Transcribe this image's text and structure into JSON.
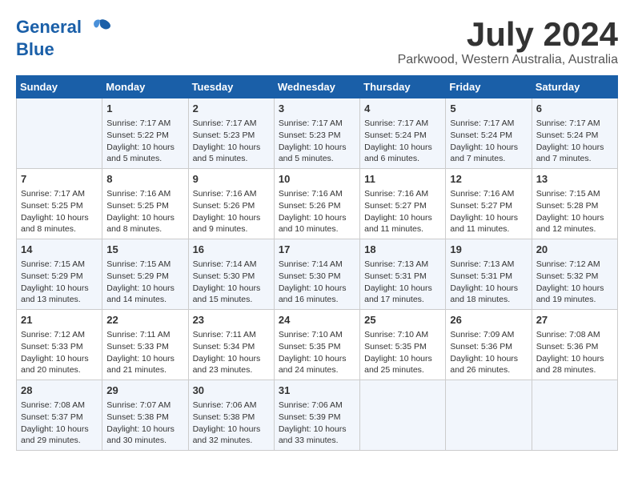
{
  "logo": {
    "line1": "General",
    "line2": "Blue"
  },
  "title": "July 2024",
  "subtitle": "Parkwood, Western Australia, Australia",
  "calendar": {
    "headers": [
      "Sunday",
      "Monday",
      "Tuesday",
      "Wednesday",
      "Thursday",
      "Friday",
      "Saturday"
    ],
    "weeks": [
      [
        {
          "day": "",
          "content": ""
        },
        {
          "day": "1",
          "content": "Sunrise: 7:17 AM\nSunset: 5:22 PM\nDaylight: 10 hours\nand 5 minutes."
        },
        {
          "day": "2",
          "content": "Sunrise: 7:17 AM\nSunset: 5:23 PM\nDaylight: 10 hours\nand 5 minutes."
        },
        {
          "day": "3",
          "content": "Sunrise: 7:17 AM\nSunset: 5:23 PM\nDaylight: 10 hours\nand 5 minutes."
        },
        {
          "day": "4",
          "content": "Sunrise: 7:17 AM\nSunset: 5:24 PM\nDaylight: 10 hours\nand 6 minutes."
        },
        {
          "day": "5",
          "content": "Sunrise: 7:17 AM\nSunset: 5:24 PM\nDaylight: 10 hours\nand 7 minutes."
        },
        {
          "day": "6",
          "content": "Sunrise: 7:17 AM\nSunset: 5:24 PM\nDaylight: 10 hours\nand 7 minutes."
        }
      ],
      [
        {
          "day": "7",
          "content": "Sunrise: 7:17 AM\nSunset: 5:25 PM\nDaylight: 10 hours\nand 8 minutes."
        },
        {
          "day": "8",
          "content": "Sunrise: 7:16 AM\nSunset: 5:25 PM\nDaylight: 10 hours\nand 8 minutes."
        },
        {
          "day": "9",
          "content": "Sunrise: 7:16 AM\nSunset: 5:26 PM\nDaylight: 10 hours\nand 9 minutes."
        },
        {
          "day": "10",
          "content": "Sunrise: 7:16 AM\nSunset: 5:26 PM\nDaylight: 10 hours\nand 10 minutes."
        },
        {
          "day": "11",
          "content": "Sunrise: 7:16 AM\nSunset: 5:27 PM\nDaylight: 10 hours\nand 11 minutes."
        },
        {
          "day": "12",
          "content": "Sunrise: 7:16 AM\nSunset: 5:27 PM\nDaylight: 10 hours\nand 11 minutes."
        },
        {
          "day": "13",
          "content": "Sunrise: 7:15 AM\nSunset: 5:28 PM\nDaylight: 10 hours\nand 12 minutes."
        }
      ],
      [
        {
          "day": "14",
          "content": "Sunrise: 7:15 AM\nSunset: 5:29 PM\nDaylight: 10 hours\nand 13 minutes."
        },
        {
          "day": "15",
          "content": "Sunrise: 7:15 AM\nSunset: 5:29 PM\nDaylight: 10 hours\nand 14 minutes."
        },
        {
          "day": "16",
          "content": "Sunrise: 7:14 AM\nSunset: 5:30 PM\nDaylight: 10 hours\nand 15 minutes."
        },
        {
          "day": "17",
          "content": "Sunrise: 7:14 AM\nSunset: 5:30 PM\nDaylight: 10 hours\nand 16 minutes."
        },
        {
          "day": "18",
          "content": "Sunrise: 7:13 AM\nSunset: 5:31 PM\nDaylight: 10 hours\nand 17 minutes."
        },
        {
          "day": "19",
          "content": "Sunrise: 7:13 AM\nSunset: 5:31 PM\nDaylight: 10 hours\nand 18 minutes."
        },
        {
          "day": "20",
          "content": "Sunrise: 7:12 AM\nSunset: 5:32 PM\nDaylight: 10 hours\nand 19 minutes."
        }
      ],
      [
        {
          "day": "21",
          "content": "Sunrise: 7:12 AM\nSunset: 5:33 PM\nDaylight: 10 hours\nand 20 minutes."
        },
        {
          "day": "22",
          "content": "Sunrise: 7:11 AM\nSunset: 5:33 PM\nDaylight: 10 hours\nand 21 minutes."
        },
        {
          "day": "23",
          "content": "Sunrise: 7:11 AM\nSunset: 5:34 PM\nDaylight: 10 hours\nand 23 minutes."
        },
        {
          "day": "24",
          "content": "Sunrise: 7:10 AM\nSunset: 5:35 PM\nDaylight: 10 hours\nand 24 minutes."
        },
        {
          "day": "25",
          "content": "Sunrise: 7:10 AM\nSunset: 5:35 PM\nDaylight: 10 hours\nand 25 minutes."
        },
        {
          "day": "26",
          "content": "Sunrise: 7:09 AM\nSunset: 5:36 PM\nDaylight: 10 hours\nand 26 minutes."
        },
        {
          "day": "27",
          "content": "Sunrise: 7:08 AM\nSunset: 5:36 PM\nDaylight: 10 hours\nand 28 minutes."
        }
      ],
      [
        {
          "day": "28",
          "content": "Sunrise: 7:08 AM\nSunset: 5:37 PM\nDaylight: 10 hours\nand 29 minutes."
        },
        {
          "day": "29",
          "content": "Sunrise: 7:07 AM\nSunset: 5:38 PM\nDaylight: 10 hours\nand 30 minutes."
        },
        {
          "day": "30",
          "content": "Sunrise: 7:06 AM\nSunset: 5:38 PM\nDaylight: 10 hours\nand 32 minutes."
        },
        {
          "day": "31",
          "content": "Sunrise: 7:06 AM\nSunset: 5:39 PM\nDaylight: 10 hours\nand 33 minutes."
        },
        {
          "day": "",
          "content": ""
        },
        {
          "day": "",
          "content": ""
        },
        {
          "day": "",
          "content": ""
        }
      ]
    ]
  }
}
